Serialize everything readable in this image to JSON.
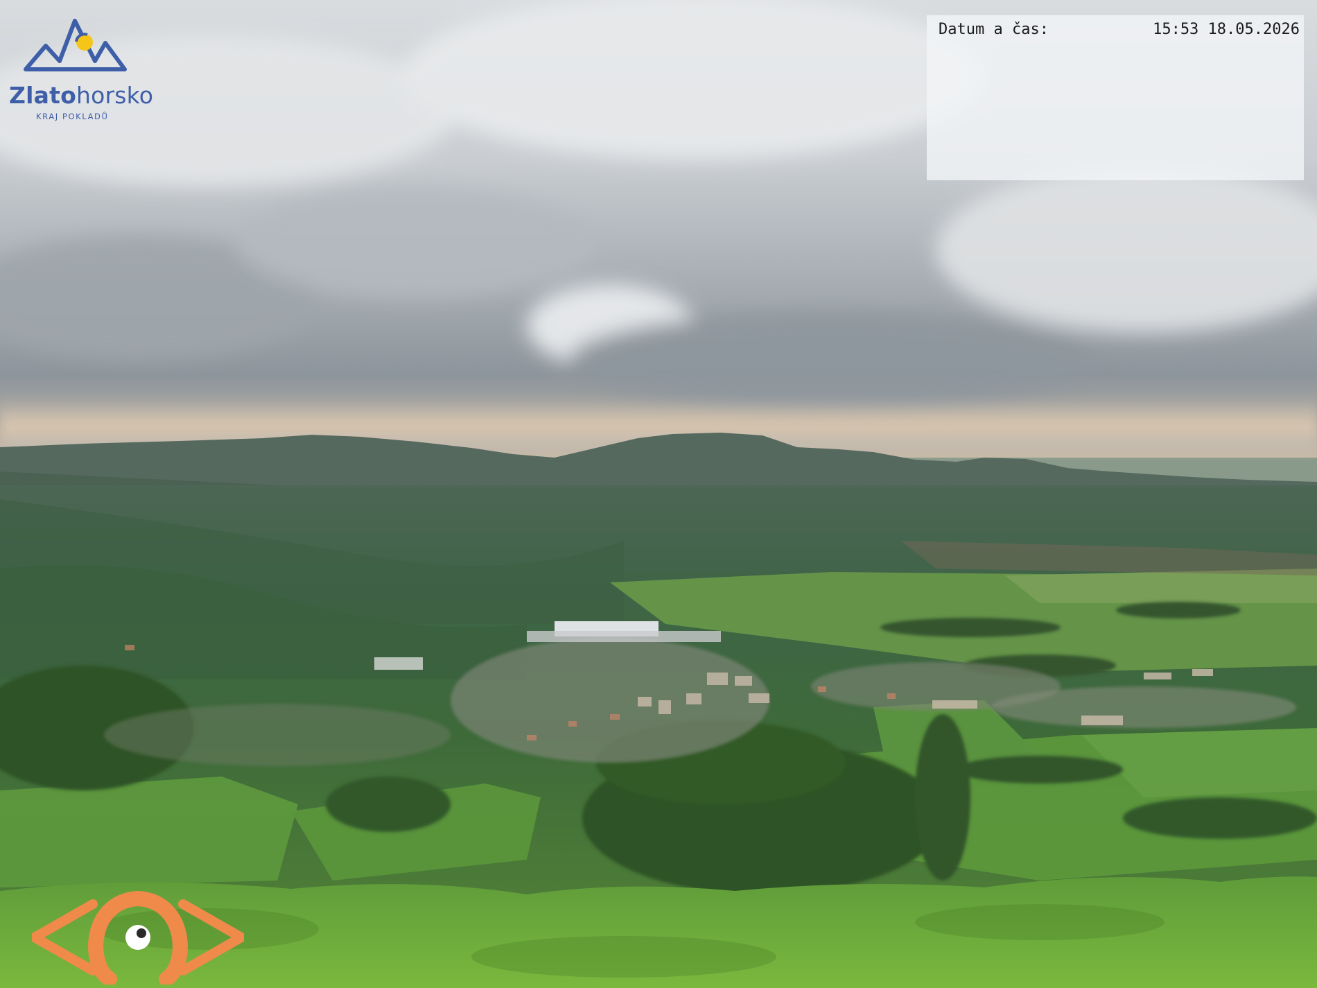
{
  "brand": {
    "name_bold": "Zlato",
    "name_regular": "horsko",
    "tagline": "KRAJ POKLADŮ",
    "color": "#3e5ea8",
    "accent": "#f5c518"
  },
  "overlay": {
    "datetime_label": "Datum a čas:",
    "datetime_value": "15:53 18.05.2026"
  },
  "watermark": {
    "icon": "eye-logo-icon",
    "color": "#f08a4b"
  }
}
